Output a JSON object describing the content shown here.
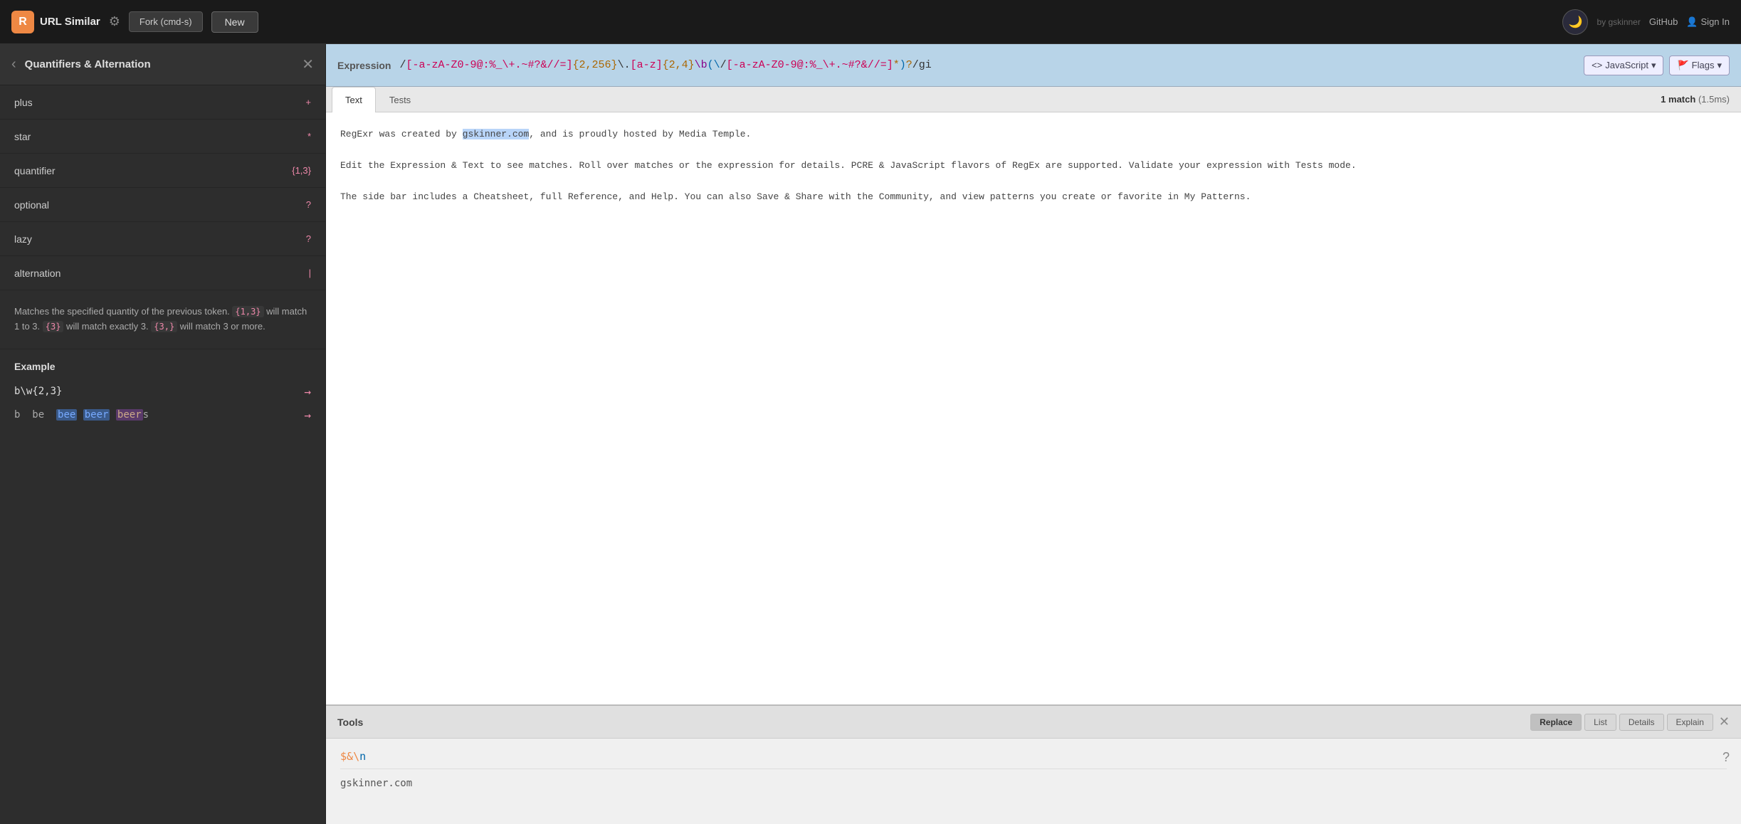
{
  "topnav": {
    "logo_text": "URL Similar",
    "logo_icon": "R",
    "fork_label": "Fork (cmd-s)",
    "new_label": "New",
    "by_text": "by gskinner",
    "github_label": "GitHub",
    "signin_label": "Sign In",
    "dark_mode_icon": "🌙"
  },
  "sidebar": {
    "title": "Quantifiers & Alternation",
    "items": [
      {
        "label": "plus",
        "badge": "+"
      },
      {
        "label": "star",
        "badge": "*"
      },
      {
        "label": "quantifier",
        "badge": "{1,3}"
      },
      {
        "label": "optional",
        "badge": "?"
      },
      {
        "label": "lazy",
        "badge": "?"
      },
      {
        "label": "alternation",
        "badge": "|"
      }
    ],
    "description": "Matches the specified quantity of the previous token. {1,3} will match 1 to 3. {3} will match exactly 3. {3,} will match 3 or more.",
    "example_title": "Example",
    "example_expr": "b\\w{2,3}",
    "example_matches_text": "b  be  bee  beer  beers",
    "example_words": [
      "b",
      "be",
      "bee",
      "beer",
      "beer",
      "s"
    ]
  },
  "expression": {
    "label": "Expression",
    "value": "/[-a-zA-Z0-9@:%_\\+.~#?&//=]{2,256}\\.[a-z]{2,4}\\b(\\/[-a-zA-Z0-9@:%_\\+.~#?&//=]*)?/gi",
    "language": "JavaScript",
    "flags": "Flags"
  },
  "text_panel": {
    "tab_text": "Text",
    "tab_tests": "Tests",
    "match_count": "1 match",
    "match_time": "(1.5ms)",
    "content_lines": [
      "RegExr was created by gskinner.com, and is proudly hosted by Media Temple.",
      "",
      "Edit the Expression & Text to see matches. Roll over matches or the expression for details. PCRE & JavaScript flavors of RegEx are supported. Validate your expression with Tests mode.",
      "",
      "The side bar includes a Cheatsheet, full Reference, and Help. You can also Save & Share with the Community, and view patterns you create or favorite in My Patterns."
    ]
  },
  "tools": {
    "label": "Tools",
    "buttons": [
      "Replace",
      "List",
      "Details",
      "Explain"
    ],
    "active_button": "Replace",
    "expression_display": "$&\\n",
    "result_text": "gskinner.com"
  }
}
